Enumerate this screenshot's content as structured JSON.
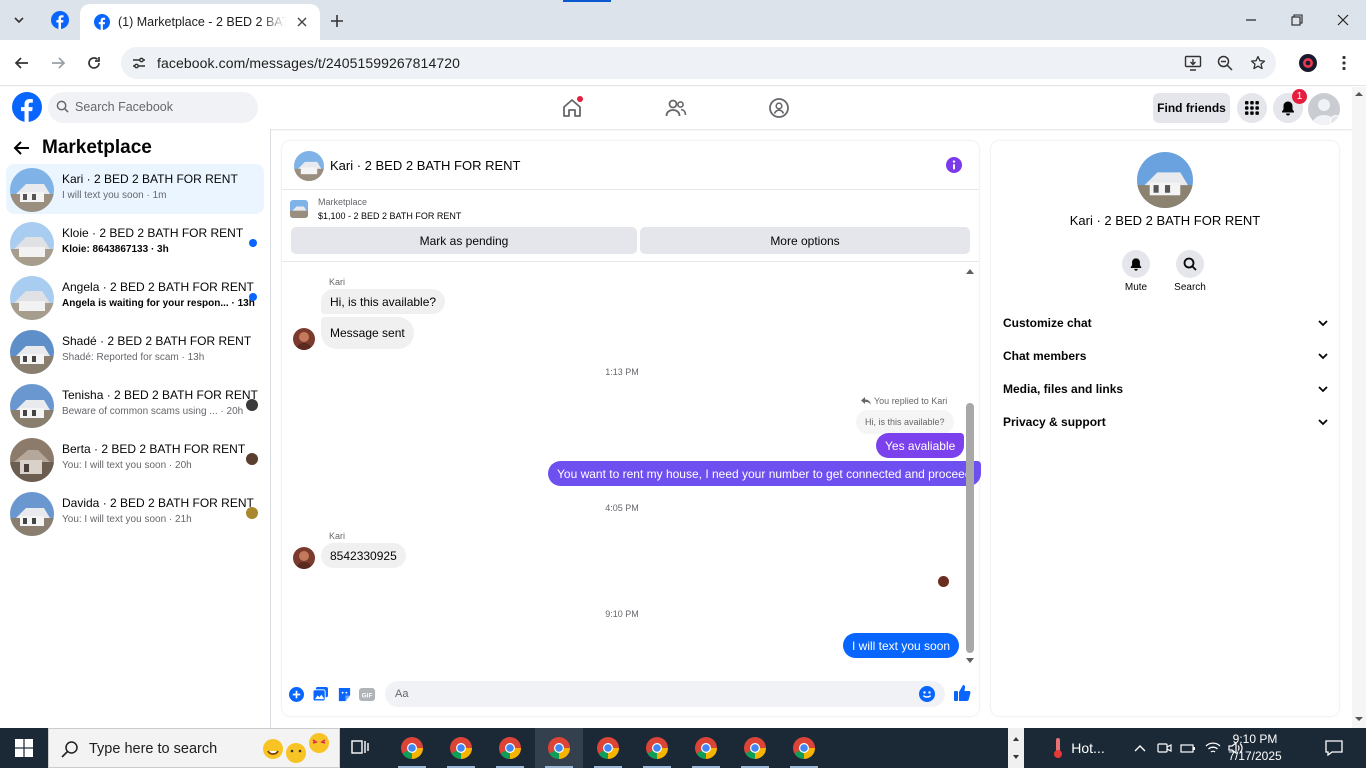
{
  "browser": {
    "tab_title": "(1) Marketplace - 2 BED 2 BATH FOR RENT",
    "url": "facebook.com/messages/t/24051599267814720"
  },
  "fb": {
    "search_placeholder": "Search Facebook",
    "find_friends": "Find friends",
    "notification_count": "1"
  },
  "left": {
    "title": "Marketplace",
    "conversations": [
      {
        "name": "Kari · 2 BED 2 BATH FOR RENT",
        "preview": "I will text you soon · 1m",
        "unread": false,
        "active": true
      },
      {
        "name": "Kloie · 2 BED 2 BATH FOR RENT",
        "preview": "Kloie: 8643867133 · 3h",
        "unread": true
      },
      {
        "name": "Angela · 2 BED 2 BATH FOR RENT",
        "preview": "Angela is waiting for your respon... · 13h",
        "unread": true
      },
      {
        "name": "Shadé · 2 BED 2 BATH FOR RENT",
        "preview": "Shadé: Reported for scam · 13h",
        "unread": false
      },
      {
        "name": "Tenisha · 2 BED 2 BATH FOR RENT",
        "preview": "Beware of common scams using ... · 20h",
        "unread": false
      },
      {
        "name": "Berta · 2 BED 2 BATH FOR RENT",
        "preview": "You: I will text you soon · 20h",
        "unread": false
      },
      {
        "name": "Davida · 2 BED 2 BATH FOR RENT",
        "preview": "You: I will text you soon · 21h",
        "unread": false
      }
    ]
  },
  "chat": {
    "title": "Kari · 2 BED 2 BATH FOR RENT",
    "marketplace_label": "Marketplace",
    "listing": "$1,100 - 2 BED 2 BATH FOR RENT",
    "mark_pending": "Mark as pending",
    "more_options": "More options",
    "sender_name": "Kari",
    "msg_1": "Hi, is this available?",
    "msg_2": "Message sent",
    "time_1": "1:13 PM",
    "replied_label": "You replied to Kari",
    "reply_quote": "Hi, is this available?",
    "msg_3": "Yes avaliable",
    "msg_4": "You want to rent my house, I need your number to get connected and proceed",
    "time_2": "4:05 PM",
    "msg_5": "8542330925",
    "time_3": "9:10 PM",
    "msg_6": "I will text you soon",
    "composer_placeholder": "Aa",
    "accent": "#0866ff",
    "purple": "#7c3aed"
  },
  "right": {
    "name": "Kari · 2 BED 2 BATH FOR RENT",
    "mute": "Mute",
    "search": "Search",
    "sections": [
      "Customize chat",
      "Chat members",
      "Media, files and links",
      "Privacy & support"
    ]
  },
  "taskbar": {
    "search_placeholder": "Type here to search",
    "weather": "Hot...",
    "time": "9:10 PM",
    "date": "7/17/2025"
  }
}
